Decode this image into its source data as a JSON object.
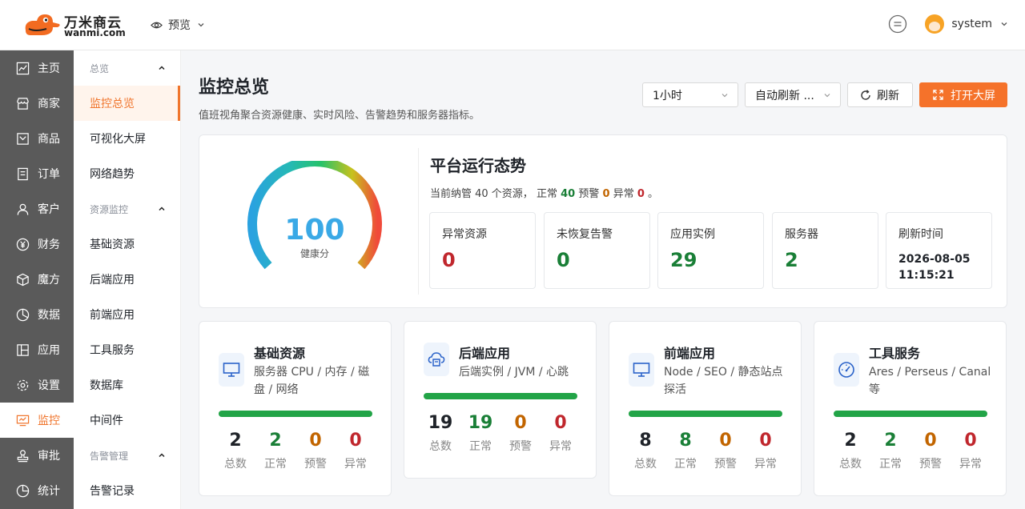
{
  "brand": {
    "name_cn": "万米商云",
    "name_en": "wanmi.com"
  },
  "topbar": {
    "preview_label": "预览",
    "user_name": "system"
  },
  "leftnav": [
    {
      "label": "主页",
      "icon": "chart-icon"
    },
    {
      "label": "商家",
      "icon": "store-icon"
    },
    {
      "label": "商品",
      "icon": "product-icon"
    },
    {
      "label": "订单",
      "icon": "order-icon"
    },
    {
      "label": "客户",
      "icon": "user-icon"
    },
    {
      "label": "财务",
      "icon": "finance-icon"
    },
    {
      "label": "魔方",
      "icon": "cube-icon"
    },
    {
      "label": "数据",
      "icon": "pie-icon"
    },
    {
      "label": "应用",
      "icon": "app-icon"
    },
    {
      "label": "设置",
      "icon": "gear-icon"
    },
    {
      "label": "监控",
      "icon": "monitor-icon",
      "active": true
    },
    {
      "label": "审批",
      "icon": "stamp-icon"
    },
    {
      "label": "统计",
      "icon": "stats-icon"
    }
  ],
  "subnav": {
    "group_overview": "总览",
    "overview_items": [
      "监控总览",
      "可视化大屏",
      "网络趋势"
    ],
    "group_resource": "资源监控",
    "resource_items": [
      "基础资源",
      "后端应用",
      "前端应用",
      "工具服务",
      "数据库",
      "中间件"
    ],
    "group_alert": "告警管理",
    "alert_items": [
      "告警记录"
    ]
  },
  "page": {
    "title": "监控总览",
    "subtitle": "值班视角聚合资源健康、实时风险、告警趋势和服务器指标。",
    "time_range": "1小时",
    "auto_refresh": "自动刷新 ...",
    "refresh_label": "刷新",
    "open_screen_label": "打开大屏"
  },
  "overview": {
    "score": "100",
    "score_label": "健康分",
    "score_value": 100,
    "title": "平台运行态势",
    "line_prefix": "当前纳管 40 个资源，",
    "normal_label": "正常",
    "normal_count": "40",
    "warn_label": "预警",
    "warn_count": "0",
    "error_label": "异常",
    "error_count": "0",
    "line_suffix": "。",
    "stats": [
      {
        "label": "异常资源",
        "value": "0",
        "color": "#c0272d"
      },
      {
        "label": "未恢复告警",
        "value": "0",
        "color": "#1a7f37"
      },
      {
        "label": "应用实例",
        "value": "29",
        "color": "#1a7f37"
      },
      {
        "label": "服务器",
        "value": "2",
        "color": "#1a7f37"
      }
    ],
    "refresh_time_label": "刷新时间",
    "refresh_time": "2026-08-05 11:15:21"
  },
  "cards": [
    {
      "title": "基础资源",
      "desc": "服务器 CPU / 内存 / 磁盘 / 网络",
      "icon": "desktop-icon",
      "total": "2",
      "normal": "2",
      "warn": "0",
      "error": "0"
    },
    {
      "title": "后端应用",
      "desc": "后端实例 / JVM / 心跳",
      "icon": "server-icon",
      "total": "19",
      "normal": "19",
      "warn": "0",
      "error": "0"
    },
    {
      "title": "前端应用",
      "desc": "Node / SEO / 静态站点探活",
      "icon": "desktop-icon",
      "total": "8",
      "normal": "8",
      "warn": "0",
      "error": "0"
    },
    {
      "title": "工具服务",
      "desc": "Ares / Perseus / Canal 等",
      "icon": "gauge-icon",
      "total": "2",
      "normal": "2",
      "warn": "0",
      "error": "0"
    }
  ],
  "card_labels": {
    "total": "总数",
    "normal": "正常",
    "warn": "预警",
    "error": "异常"
  }
}
